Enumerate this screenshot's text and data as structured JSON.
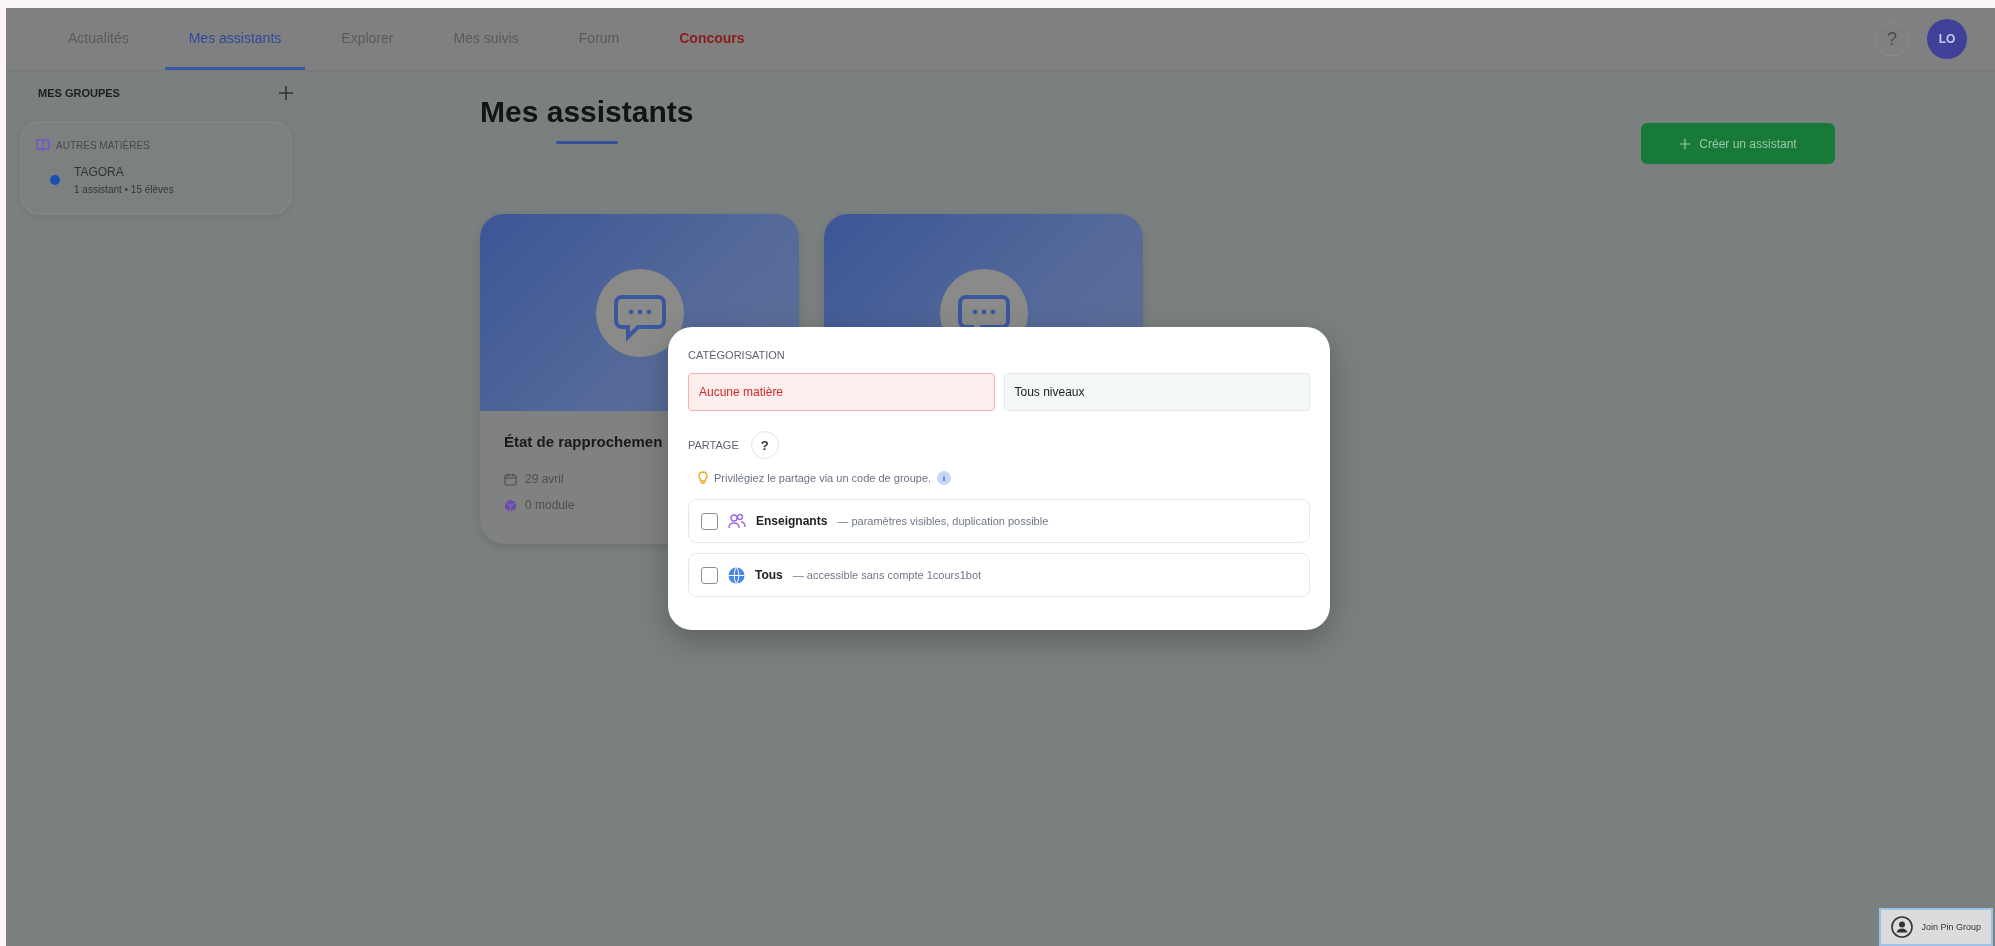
{
  "nav": {
    "tabs": [
      {
        "label": "Actualités",
        "selected": false,
        "kind": "regular"
      },
      {
        "label": "Mes assistants",
        "selected": true,
        "kind": "regular"
      },
      {
        "label": "Explorer",
        "selected": false,
        "kind": "regular"
      },
      {
        "label": "Mes suivis",
        "selected": false,
        "kind": "regular"
      },
      {
        "label": "Forum",
        "selected": false,
        "kind": "regular"
      },
      {
        "label": "Concours",
        "selected": false,
        "kind": "promo"
      }
    ],
    "help": "?",
    "avatar": "LO"
  },
  "sidebar": {
    "title": "MES GROUPES",
    "groups": [
      {
        "category": "AUTRES MATIÈRES",
        "items": [
          {
            "name": "TAGORA",
            "meta": "1 assistant • 15 élèves",
            "color": "#1a4fb0"
          }
        ]
      }
    ]
  },
  "main": {
    "title": "Mes assistants",
    "create_button": "Créer un assistant",
    "cards": [
      {
        "kind": "assistant",
        "title": "État de rapprochemen",
        "date": "29 avril",
        "modules": "0 module"
      },
      {
        "kind": "assistant"
      }
    ]
  },
  "dialog": {
    "categorisation": {
      "title": "CATÉGORISATION",
      "subject": {
        "value": "Aucune matière",
        "invalid": true
      },
      "level": {
        "value": "Tous niveaux",
        "invalid": false
      }
    },
    "sharing": {
      "title": "PARTAGE",
      "help": "?",
      "tip": "Privilégiez le partage via un code de groupe.",
      "options": [
        {
          "kind": "teachers",
          "label": "Enseignants",
          "description": "— paramètres visibles, duplication possible",
          "checked": false
        },
        {
          "kind": "public",
          "label": "Tous",
          "description": "— accessible sans compte 1cours1bot",
          "checked": false
        }
      ]
    }
  },
  "floating_button": "Join Pin Group"
}
